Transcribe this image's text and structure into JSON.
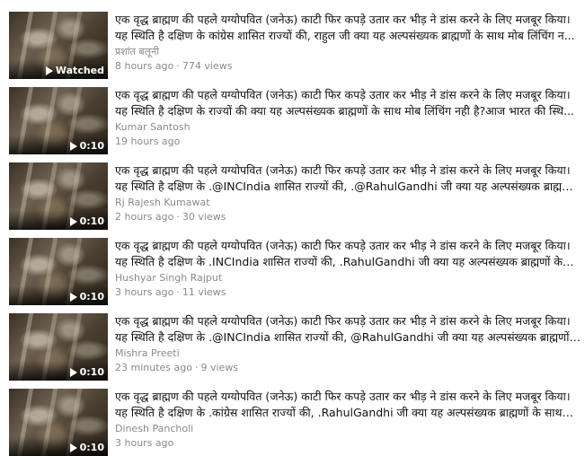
{
  "videos": [
    {
      "title": "एक वृद्ध ब्राह्मण की पहले यग्योपवित (जनेऊ) काटी फिर कपड़े उतार कर भीड़ ने डांस करने के लिए मजबूर किया। यह स्थिति है दक्षिण के कांग्रेस शासित राज्यों की, राहुल जी क्या यह अल्पसंख्यक ब्राह्मणों के साथ मोब लिंचिंग न...",
      "channel": "प्रशांत बलूनी",
      "badge": "Watched",
      "age": "8 hours ago",
      "views": "774 views"
    },
    {
      "title": "एक वृद्ध ब्राह्मण की पहले यग्योपवित (जनेऊ) काटी फिर कपड़े उतार कर भीड़ ने डांस करने के लिए मजबूर किया। यह स्थिति है दक्षिण के राज्यों की क्या यह अल्पसंख्यक ब्राह्मणों के साथ मोब लिंचिंग नही है?आज भारत की स्थि...",
      "channel": "Kumar Santosh",
      "badge": "0:10",
      "age": "19 hours ago",
      "views": ""
    },
    {
      "title": "एक वृद्ध ब्राह्मण की पहले यग्योपवित (जनेऊ) काटी फिर कपड़े उतार कर भीड़ ने डांस करने के लिए मजबूर किया। यह स्थिति है दक्षिण के .@INCIndia शासित राज्यों की, .@RahulGandhi जी क्या यह अल्पसंख्यक ब्राह्मणों के...",
      "channel": "Rj Rajesh Kumawat",
      "badge": "0:10",
      "age": "2 hours ago",
      "views": "30 views"
    },
    {
      "title": "एक वृद्ध ब्राह्मण की पहले यग्योपवित (जनेऊ) काटी फिर कपड़े उतार कर भीड़ ने डांस करने के लिए मजबूर किया। यह स्थिति है दक्षिण के .INCIndia शासित राज्यों की, .RahulGandhi जी क्या यह अल्पसंख्यक ब्राह्मणों के साथ...",
      "channel": "Hushyar Singh Rajput",
      "badge": "0:10",
      "age": "3 hours ago",
      "views": "11 views"
    },
    {
      "title": "एक वृद्ध ब्राह्मण की पहले यग्योपवित (जनेऊ) काटी फिर कपड़े उतार कर भीड़ ने डांस करने के लिए मजबूर किया। यह स्थिति है दक्षिण के .@INCIndia शासित राज्यों की, @RahulGandhi जी क्या यह अल्पसंख्यक ब्राह्मणों के...",
      "channel": "Mishra Preeti",
      "badge": "0:10",
      "age": "23 minutes ago",
      "views": "9 views"
    },
    {
      "title": "एक वृद्ध ब्राह्मण की पहले यग्योपवित (जनेऊ) काटी फिर कपड़े उतार कर भीड़ ने डांस करने के लिए मजबूर किया। यह स्थिति है दक्षिण के .कांग्रेस शासित राज्यों की, .RahulGandhi जी क्या यह अल्पसंख्यक ब्राह्मणों के साथ मो...",
      "channel": "Dinesh Pancholi",
      "badge": "0:10",
      "age": "3 hours ago",
      "views": ""
    }
  ]
}
